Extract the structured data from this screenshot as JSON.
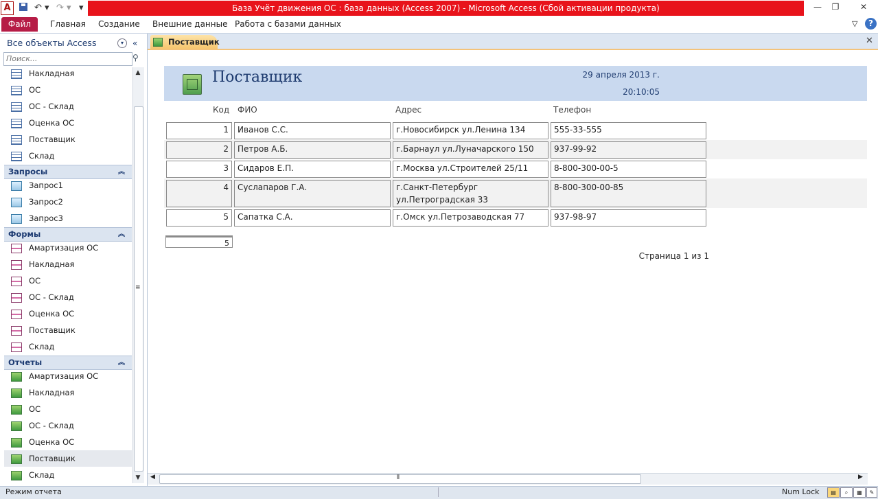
{
  "window": {
    "title": "База Учёт движения ОС : база данных (Access 2007)  -  Microsoft Access (Сбой активации продукта)"
  },
  "ribbon": {
    "tabs": [
      "Файл",
      "Главная",
      "Создание",
      "Внешние данные",
      "Работа с базами данных"
    ]
  },
  "nav": {
    "header": "Все объекты Access",
    "search_placeholder": "Поиск...",
    "tables": [
      "Накладная",
      "ОС",
      "ОС - Склад",
      "Оценка ОС",
      "Поставщик",
      "Склад"
    ],
    "queries_title": "Запросы",
    "queries": [
      "Запрос1",
      "Запрос2",
      "Запрос3"
    ],
    "forms_title": "Формы",
    "forms": [
      "Амартизация ОС",
      "Накладная",
      "ОС",
      "ОС - Склад",
      "Оценка ОС",
      "Поставщик",
      "Склад"
    ],
    "reports_title": "Отчеты",
    "reports": [
      "Амартизация ОС",
      "Накладная",
      "ОС",
      "ОС - Склад",
      "Оценка ОС",
      "Поставщик",
      "Склад"
    ],
    "selected_report": "Поставщик"
  },
  "doc_tab": {
    "label": "Поставщик"
  },
  "report": {
    "title": "Поставщик",
    "date": "29 апреля 2013 г.",
    "time": "20:10:05",
    "columns": [
      "Код",
      "ФИО",
      "Адрес",
      "Телефон"
    ],
    "rows": [
      {
        "id": "1",
        "fio": "Иванов С.С.",
        "address": "г.Новосибирск ул.Ленина 134",
        "phone": "555-33-555"
      },
      {
        "id": "2",
        "fio": "Петров А.Б.",
        "address": "г.Барнаул ул.Луначарского 150",
        "phone": "937-99-92"
      },
      {
        "id": "3",
        "fio": "Сидаров Е.П.",
        "address": "г.Москва ул.Строителей 25/11",
        "phone": "8-800-300-00-5"
      },
      {
        "id": "4",
        "fio": "Суслапаров Г.А.",
        "address_line1": "г.Санкт-Петербург",
        "address_line2": "ул.Петроградская 33",
        "phone": "8-800-300-00-85"
      },
      {
        "id": "5",
        "fio": "Сапатка С.А.",
        "address": "г.Омск ул.Петрозаводская 77",
        "phone": "937-98-97"
      }
    ],
    "total": "5",
    "page_info": "Страница 1 из 1"
  },
  "statusbar": {
    "mode": "Режим отчета",
    "numlock": "Num Lock"
  }
}
